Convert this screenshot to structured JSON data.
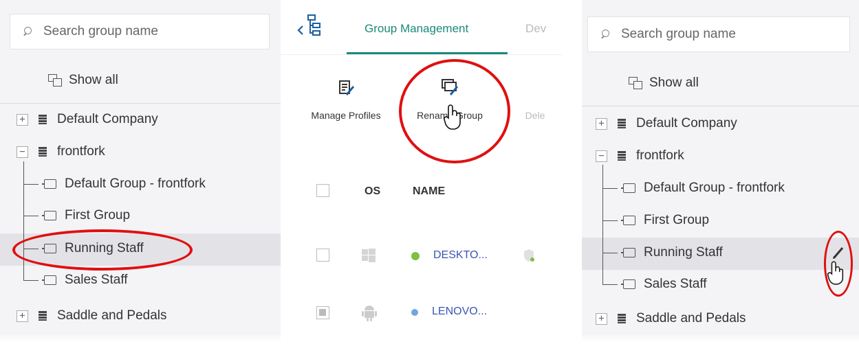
{
  "left_panel": {
    "search_placeholder": "Search group name",
    "show_all": "Show all",
    "tree": {
      "company1": "Default Company",
      "company2": "frontfork",
      "group1": "Default Group - frontfork",
      "group2": "First Group",
      "group3": "Running Staff",
      "group4": "Sales Staff",
      "company3": "Saddle and Pedals"
    },
    "expand_plus": "+",
    "expand_minus": "−"
  },
  "middle_panel": {
    "tabs": {
      "active": "Group Management",
      "next": "Dev"
    },
    "toolbar": {
      "manage_profiles": "Manage Profiles",
      "rename_group": "Rename Group",
      "delete": "Dele"
    },
    "table": {
      "col_os": "OS",
      "col_name": "NAME",
      "rows": [
        {
          "os": "windows",
          "status_color": "#7cc142",
          "name": "DESKTO..."
        },
        {
          "os": "android",
          "status_color": "#6fa8dc",
          "name": "LENOVO..."
        }
      ]
    }
  },
  "right_panel": {
    "search_placeholder": "Search group name",
    "show_all": "Show all",
    "tree": {
      "company1": "Default Company",
      "company2": "frontfork",
      "group1": "Default Group - frontfork",
      "group2": "First Group",
      "group3": "Running Staff",
      "group4": "Sales Staff",
      "company3": "Saddle and Pedals"
    },
    "expand_plus": "+",
    "expand_minus": "−"
  },
  "colors": {
    "accent": "#1a8a78",
    "annotation": "#e01010",
    "link": "#3a55b4",
    "selected_row": "#e3e3e7"
  },
  "icons": [
    "search-icon",
    "show-all-icon",
    "company-icon",
    "group-icon",
    "tree-toggle-icon",
    "manage-profiles-icon",
    "rename-group-icon",
    "windows-icon",
    "android-icon",
    "edit-pencil-icon",
    "hand-cursor-icon",
    "back-chevron-icon",
    "tree-view-icon"
  ]
}
